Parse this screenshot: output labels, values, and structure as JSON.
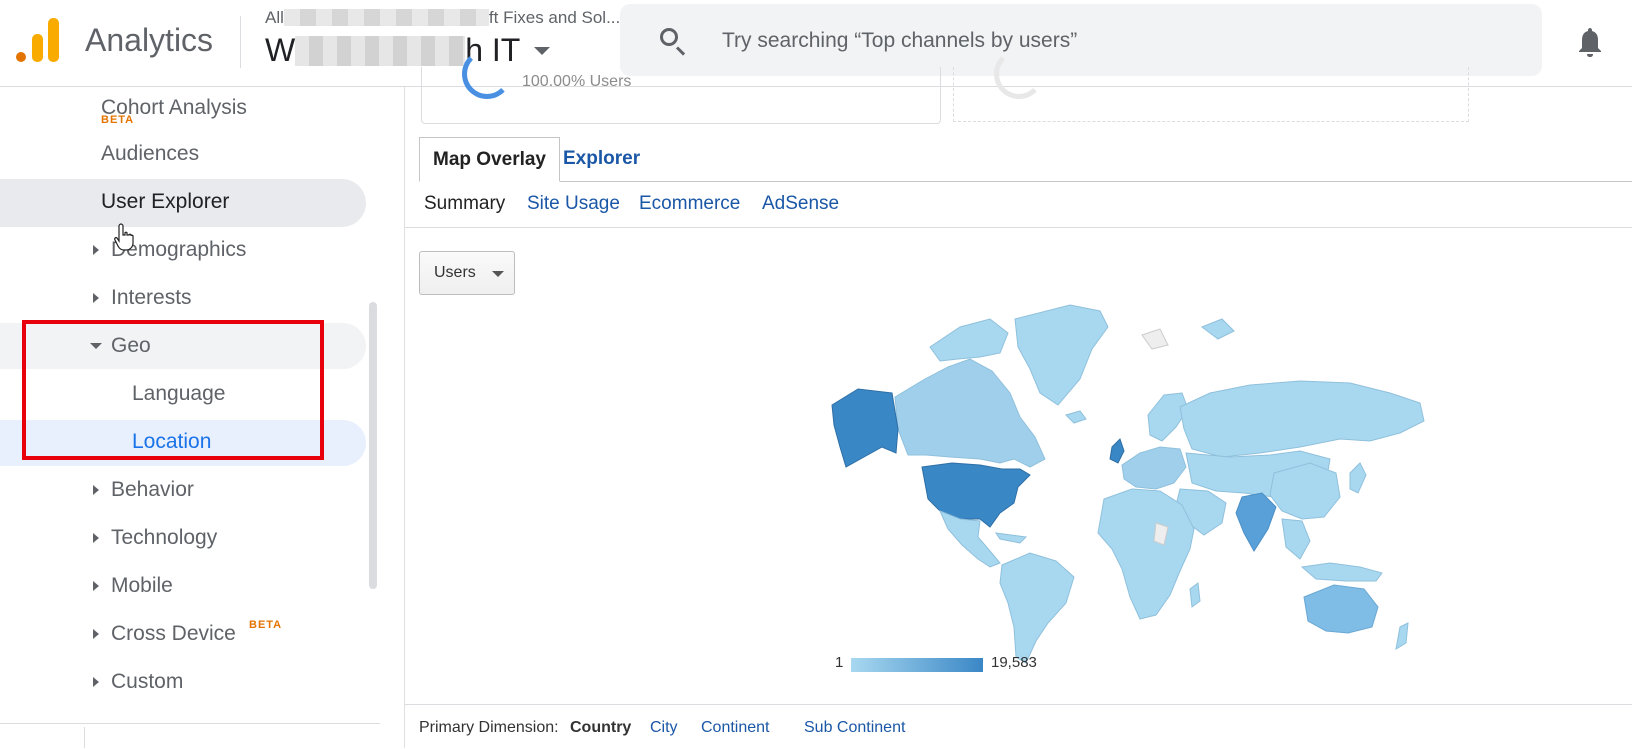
{
  "header": {
    "app_title": "Analytics",
    "account_prefix": "All",
    "account_suffix": "ft Fixes and Sol...",
    "property_prefix": "W",
    "property_suffix": "h IT",
    "search_placeholder": "Try searching “Top channels by users”"
  },
  "sidebar": {
    "cohort": {
      "label": "Cohort Analysis",
      "badge": "BETA"
    },
    "audiences": "Audiences",
    "user_explorer": "User Explorer",
    "demographics": "Demographics",
    "interests": "Interests",
    "geo": "Geo",
    "language": "Language",
    "location": "Location",
    "behavior": "Behavior",
    "technology": "Technology",
    "mobile": "Mobile",
    "cross_device": {
      "label": "Cross Device",
      "badge": "BETA"
    },
    "custom": "Custom"
  },
  "main": {
    "card_text": "100.00% Users",
    "tabs": {
      "map_overlay": "Map Overlay",
      "explorer": "Explorer"
    },
    "subtabs": {
      "summary": "Summary",
      "site_usage": "Site Usage",
      "ecommerce": "Ecommerce",
      "adsense": "AdSense"
    },
    "metric_select": "Users",
    "legend": {
      "min": "1",
      "max": "19,583"
    },
    "primary_dimension": {
      "label": "Primary Dimension:",
      "country": "Country",
      "city": "City",
      "continent": "Continent",
      "sub_continent": "Sub Continent"
    }
  },
  "colors": {
    "accent": "#1a57a6",
    "highlight_box": "#e8000b",
    "map_high": "#3a87c6",
    "map_low": "#a8d8f0"
  }
}
